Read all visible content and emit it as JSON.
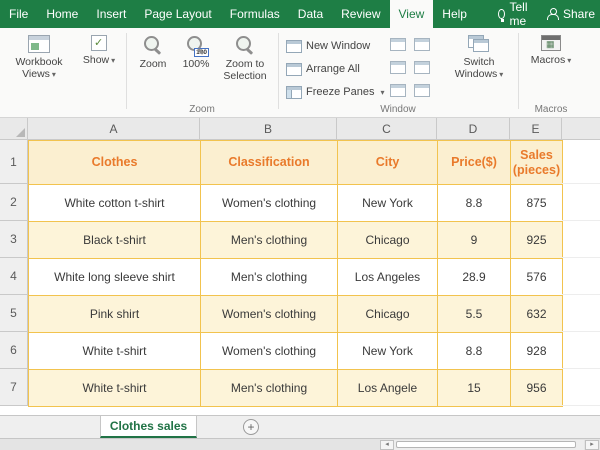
{
  "colors": {
    "excel_green": "#1E7E45",
    "sheet_tab_green": "#217346",
    "table_header_orange": "#E97A2B",
    "table_border_gold": "#F2C34E",
    "band_fill": "#FDF4D9",
    "header_fill": "#FBEFD0"
  },
  "ribbon": {
    "tabs": [
      "File",
      "Home",
      "Insert",
      "Page Layout",
      "Formulas",
      "Data",
      "Review",
      "View",
      "Help"
    ],
    "active_tab": "View",
    "tell_me": "Tell me",
    "share": "Share",
    "workbook_views": "Workbook Views",
    "show": "Show",
    "zoom_group": {
      "label": "Zoom",
      "zoom": "Zoom",
      "zoom_100": "100%",
      "icon_100": "100",
      "zoom_to_selection": "Zoom to Selection"
    },
    "window_group": {
      "label": "Window",
      "new_window": "New Window",
      "arrange_all": "Arrange All",
      "freeze_panes": "Freeze Panes",
      "switch_windows": "Switch Windows"
    },
    "macros_group": {
      "label": "Macros",
      "macros": "Macros"
    }
  },
  "grid": {
    "columns": [
      "A",
      "B",
      "C",
      "D",
      "E"
    ],
    "rows": [
      "1",
      "2",
      "3",
      "4",
      "5",
      "6",
      "7"
    ]
  },
  "table": {
    "headers": [
      "Clothes",
      "Classification",
      "City",
      "Price($)",
      "Sales (pieces)"
    ],
    "rows": [
      [
        "White cotton t-shirt",
        "Women's clothing",
        "New York",
        "8.8",
        "875"
      ],
      [
        "Black t-shirt",
        "Men's clothing",
        "Chicago",
        "9",
        "925"
      ],
      [
        "White long sleeve shirt",
        "Men's clothing",
        "Los Angeles",
        "28.9",
        "576"
      ],
      [
        "Pink shirt",
        "Women's clothing",
        "Chicago",
        "5.5",
        "632"
      ],
      [
        "White t-shirt",
        "Women's clothing",
        "New York",
        "8.8",
        "928"
      ],
      [
        "White t-shirt",
        "Men's clothing",
        "Los Angele",
        "15",
        "956"
      ]
    ]
  },
  "sheet_bar": {
    "active_sheet": "Clothes sales"
  }
}
